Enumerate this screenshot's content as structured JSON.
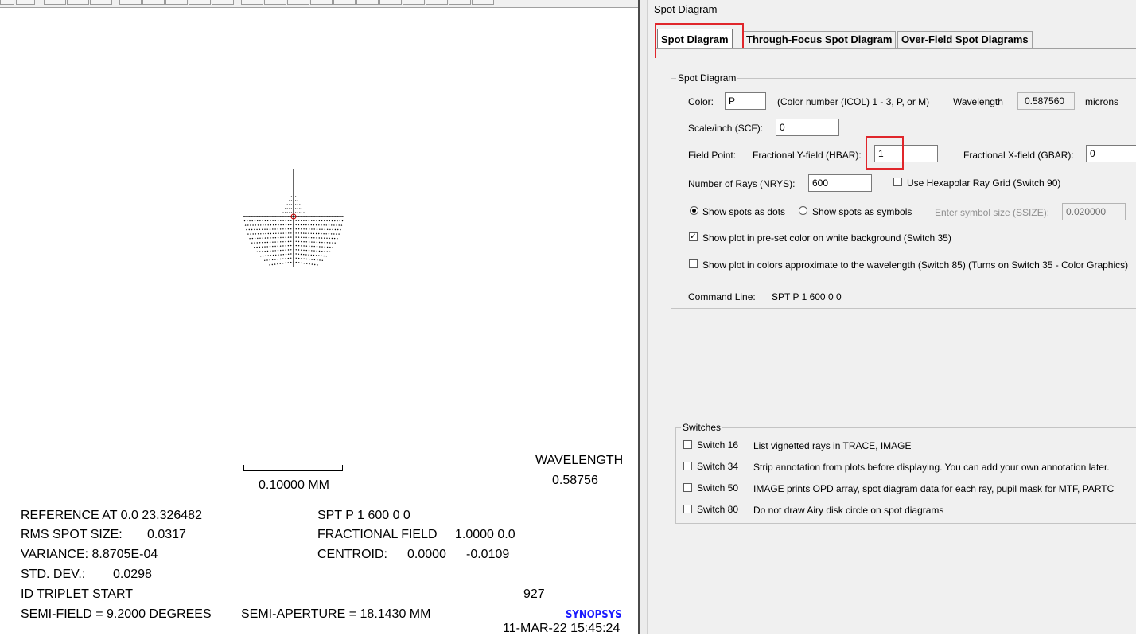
{
  "dialog": {
    "title": "Spot Diagram",
    "tabs": [
      "Spot Diagram",
      "Through-Focus Spot Diagram",
      "Over-Field Spot Diagrams"
    ],
    "active_tab": "Spot Diagram"
  },
  "spot_group": {
    "title": "Spot Diagram",
    "color_label": "Color:",
    "color_value": "P",
    "color_hint": "(Color number (ICOL) 1 - 3, P, or M)",
    "wavelength_label": "Wavelength",
    "wavelength_value": "0.587560",
    "wavelength_unit": "microns",
    "scale_label": "Scale/inch (SCF):",
    "scale_value": "0",
    "field_point_label": "Field Point:",
    "hbar_label": "Fractional Y-field (HBAR):",
    "hbar_value": "1",
    "gbar_label": "Fractional X-field (GBAR):",
    "gbar_value": "0",
    "nrays_label": "Number of Rays (NRYS):",
    "nrays_value": "600",
    "hexapolar_label": "Use Hexapolar Ray Grid (Switch 90)",
    "hexapolar_checked": false,
    "dots_label": "Show spots as dots",
    "dots_selected": true,
    "symbols_label": "Show spots as symbols",
    "symbol_size_label": "Enter symbol size (SSIZE):",
    "symbol_size_value": "0.020000",
    "preset_label": "Show plot in pre-set color on white background (Switch 35)",
    "preset_checked": true,
    "wavecolor_label": "Show plot in colors approximate to the wavelength (Switch 85) (Turns on Switch 35 - Color Graphics)",
    "wavecolor_checked": false,
    "command_label": "Command Line:",
    "command_value": "SPT P 1 600 0 0"
  },
  "switches": {
    "title": "Switches",
    "items": [
      {
        "label": "Switch 16",
        "desc": "List vignetted rays in TRACE, IMAGE",
        "checked": false
      },
      {
        "label": "Switch 34",
        "desc": "Strip annotation from plots before displaying. You can add your own annotation later.",
        "checked": false
      },
      {
        "label": "Switch 50",
        "desc": "IMAGE prints OPD array, spot diagram data for each ray, pupil mask for MTF, PARTC",
        "checked": false
      },
      {
        "label": "Switch 80",
        "desc": "Do not draw Airy disk circle on spot diagrams",
        "checked": false
      }
    ]
  },
  "plot": {
    "wavelength_label": "WAVELENGTH",
    "wavelength_value": "0.58756",
    "scale_bar_label": "0.10000 MM",
    "reference": "REFERENCE AT  0.0   23.326482",
    "rms_label": "RMS SPOT SIZE:",
    "rms_value": "0.0317",
    "variance": "VARIANCE:  8.8705E-04",
    "std_label": "STD. DEV.:",
    "std_value": "0.0298",
    "id": "ID TRIPLET START",
    "semi_field": "SEMI-FIELD =     9.2000 DEGREES",
    "semi_aperture": "SEMI-APERTURE  =  18.1430 MM",
    "spt_cmd": "SPT P 1 600 0 0",
    "frac_label": "FRACTIONAL FIELD",
    "frac_value": "1.0000  0.0",
    "centroid_label": "CENTROID:",
    "centroid_x": "0.0000",
    "centroid_y": "-0.0109",
    "id_number": "927",
    "brand": "SYNOPSYS",
    "timestamp": "11-MAR-22  15:45:24"
  },
  "colors": {
    "highlight": "#e0262b",
    "brand": "#1a1aff",
    "plot_dot": "#000000",
    "center_mark": "#cc0000"
  }
}
